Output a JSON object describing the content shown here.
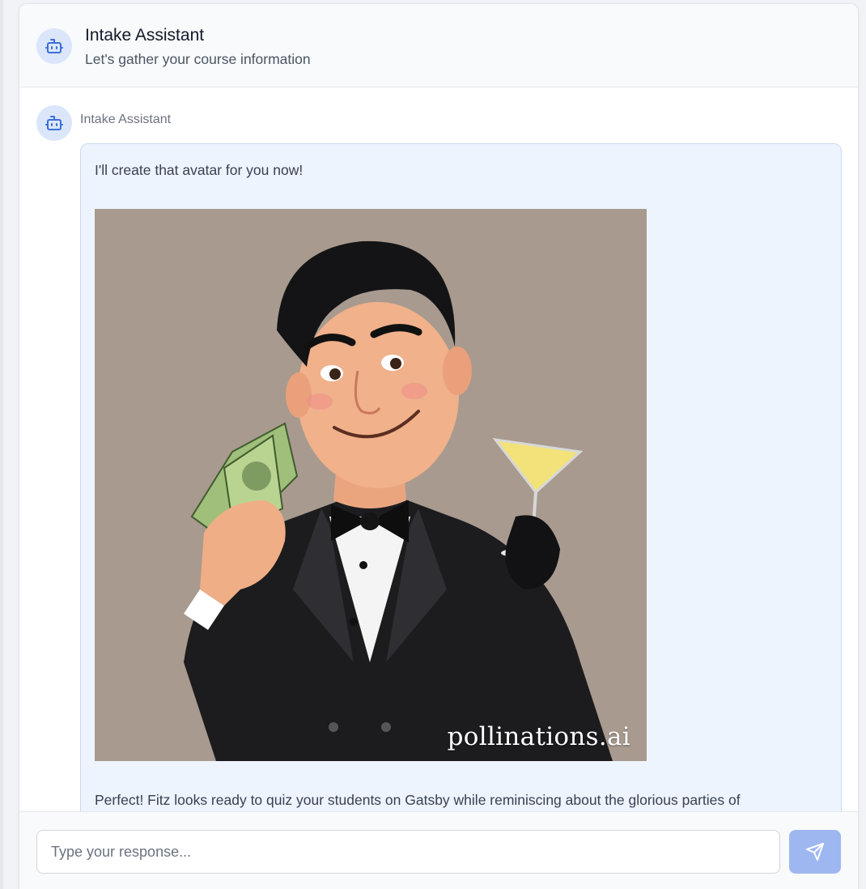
{
  "header": {
    "title": "Intake Assistant",
    "subtitle": "Let's gather your course information",
    "avatar_icon": "bot-icon"
  },
  "message": {
    "sender": "Intake Assistant",
    "avatar_icon": "bot-icon",
    "text_before_image": "I'll create that avatar for you now!",
    "image": {
      "description_icon": "generated-avatar-image",
      "watermark": "pollinations.ai"
    },
    "text_after_image": "Perfect! Fitz looks ready to quiz your students on Gatsby while reminiscing about the glorious parties of"
  },
  "composer": {
    "placeholder": "Type your response...",
    "value": "",
    "send_icon": "send-icon"
  },
  "colors": {
    "accent": "#9fb7f0",
    "avatar_bg": "#dbe6fb",
    "bubble_bg": "#eef4fe",
    "bubble_border": "#c9daf5",
    "icon_blue": "#3b6fd8"
  }
}
